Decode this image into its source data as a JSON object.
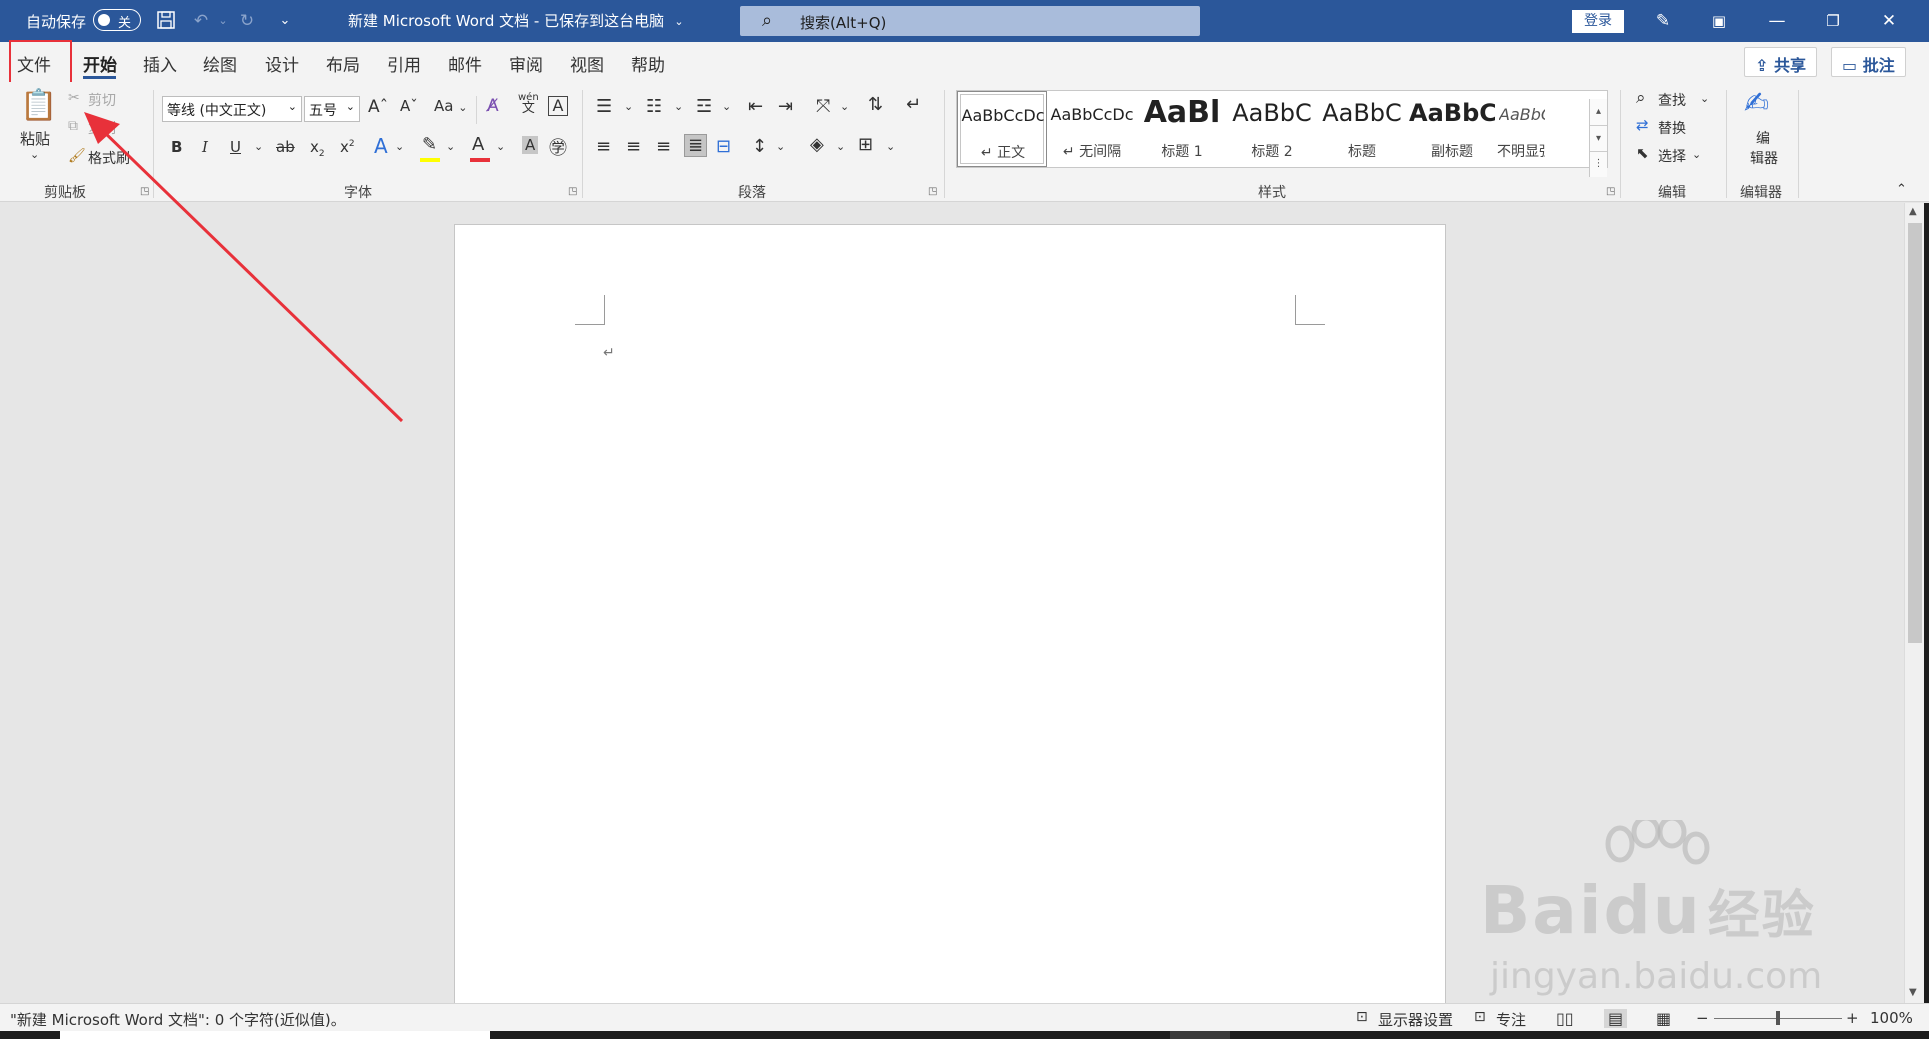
{
  "titlebar": {
    "autosave_label": "自动保存",
    "autosave_state": "关",
    "doc_title": "新建 Microsoft Word 文档 - 已保存到这台电脑",
    "search_placeholder": "搜索(Alt+Q)",
    "signin_label": "登录"
  },
  "tabs": [
    "文件",
    "开始",
    "插入",
    "绘图",
    "设计",
    "布局",
    "引用",
    "邮件",
    "审阅",
    "视图",
    "帮助"
  ],
  "share": {
    "share_label": "共享",
    "comment_label": "批注"
  },
  "ribbon": {
    "clipboard": {
      "paste": "粘贴",
      "cut": "剪切",
      "copy": "复制",
      "format_painter": "格式刷",
      "group": "剪贴板"
    },
    "font": {
      "font_name": "等线 (中文正文)",
      "font_size": "五号",
      "case": "Aa",
      "group": "字体",
      "phonetic_top": "wén",
      "phonetic_bottom": "文"
    },
    "paragraph": {
      "group": "段落"
    },
    "styles": {
      "items": [
        {
          "preview": "AaBbCcDc",
          "name": "正文"
        },
        {
          "preview": "AaBbCcDc",
          "name": "无间隔"
        },
        {
          "preview": "AaBl",
          "name": "标题 1"
        },
        {
          "preview": "AaBbC",
          "name": "标题 2"
        },
        {
          "preview": "AaBbC",
          "name": "标题"
        },
        {
          "preview": "AaBbC",
          "name": "副标题"
        },
        {
          "preview": "AaBbCcDc",
          "name": "不明显强调"
        }
      ],
      "group": "样式"
    },
    "editing": {
      "find": "查找",
      "replace": "替换",
      "select": "选择",
      "group": "编辑"
    },
    "editor": {
      "label_line1": "编",
      "label_line2": "辑器",
      "group": "编辑器"
    }
  },
  "statusbar": {
    "word_count": "\"新建 Microsoft Word 文档\": 0 个字符(近似值)。",
    "display_settings": "显示器设置",
    "focus": "专注",
    "zoom": "100%",
    "zoom_level": 0.5
  },
  "watermark": {
    "brand": "Bai",
    "brand_suffix": "du",
    "brand_cn": "经验",
    "url": "jingyan.baidu.com"
  },
  "colors": {
    "title_bar": "#2b579a",
    "annotation": "#e8313a",
    "font_color_bar": "#e8313a",
    "highlight_bar": "#ffff00"
  }
}
